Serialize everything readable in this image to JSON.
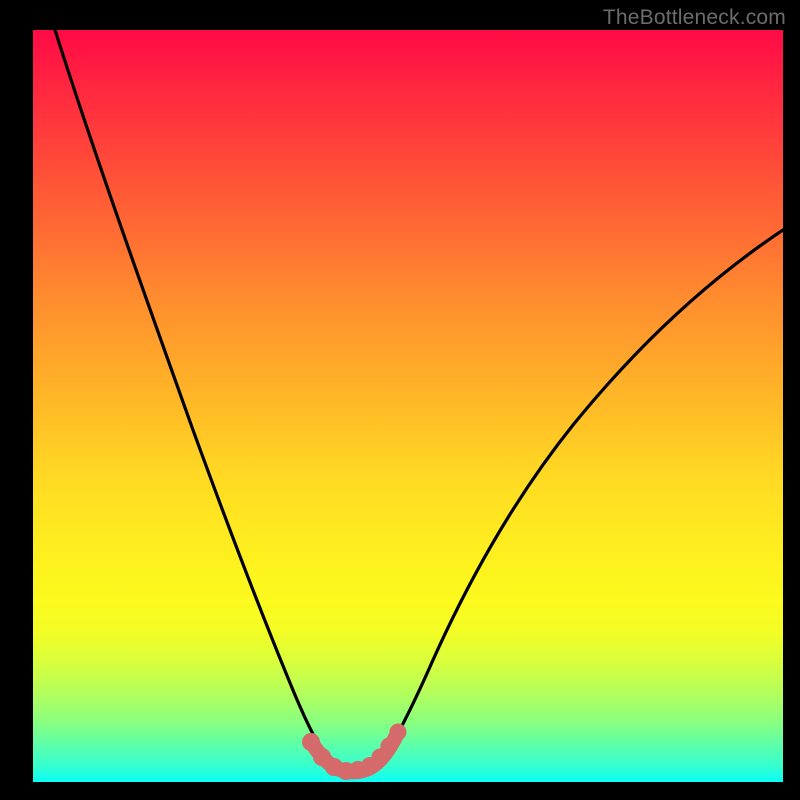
{
  "watermark": "TheBottleneck.com",
  "chart_data": {
    "type": "line",
    "title": "",
    "xlabel": "",
    "ylabel": "",
    "xlim": [
      0,
      100
    ],
    "ylim": [
      0,
      100
    ],
    "grid": false,
    "series": [
      {
        "name": "left-curve",
        "x": [
          3,
          5,
          8,
          12,
          16,
          20,
          24,
          27,
          30,
          32,
          34,
          35.5,
          37,
          38.5,
          40
        ],
        "values": [
          100,
          93,
          83,
          70,
          57,
          45,
          34,
          25,
          18,
          13,
          9,
          6.5,
          4.5,
          3,
          2
        ]
      },
      {
        "name": "right-curve",
        "x": [
          46,
          48,
          50,
          53,
          57,
          62,
          68,
          75,
          82,
          90,
          100
        ],
        "values": [
          2,
          4,
          7,
          11,
          17,
          24,
          32,
          40,
          47,
          54,
          62
        ]
      },
      {
        "name": "bottom-band",
        "x": [
          37,
          38,
          39,
          40,
          41,
          42,
          43,
          44,
          45,
          46.5,
          47.5,
          48.5
        ],
        "values": [
          3.8,
          3.0,
          2.4,
          1.9,
          1.6,
          1.5,
          1.55,
          1.8,
          2.2,
          3.0,
          4.0,
          5.2
        ]
      }
    ],
    "markers": {
      "name": "bottom-band",
      "color": "#d46a6a",
      "points_x": [
        37.0,
        38.5,
        40.0,
        41.5,
        43.0,
        44.5,
        46.0,
        47.3,
        48.6
      ],
      "points_y": [
        3.8,
        2.8,
        1.9,
        1.55,
        1.55,
        1.9,
        2.6,
        3.6,
        5.0
      ]
    },
    "colors": {
      "gradient_top": "#ff0a46",
      "gradient_mid": "#ffdd22",
      "gradient_bottom": "#0bfff7",
      "curve": "#000000",
      "band": "#d46a6a"
    }
  }
}
